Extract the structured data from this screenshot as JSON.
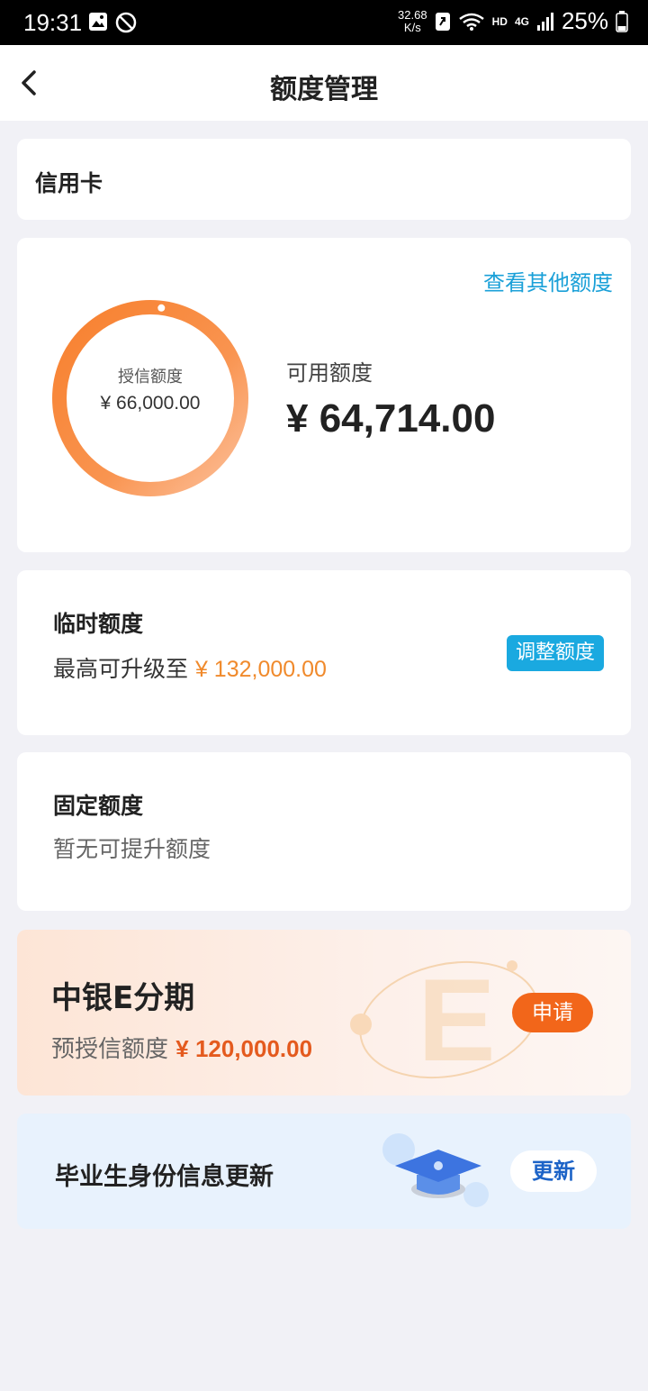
{
  "status_bar": {
    "time": "19:31",
    "speed": "32.68",
    "speed_unit": "K/s",
    "hd": "HD",
    "network": "4G",
    "battery": "25%"
  },
  "nav": {
    "back_icon": "chevron-left-icon",
    "title": "额度管理"
  },
  "card_type": {
    "label": "信用卡"
  },
  "limit_card": {
    "other_link": "查看其他额度",
    "ring_label": "授信额度",
    "ring_value": "¥ 66,000.00",
    "available_label": "可用额度",
    "available_value": "¥ 64,714.00",
    "ring_used_fraction": 0.0195,
    "ring_color": "#f7802e"
  },
  "temp_limit": {
    "title": "临时额度",
    "desc_prefix": "最高可升级至 ",
    "amount": "¥ 132,000.00",
    "button": "调整额度"
  },
  "fixed_limit": {
    "title": "固定额度",
    "desc": "暂无可提升额度"
  },
  "installment": {
    "title": "中银E分期",
    "desc_prefix": "预授信额度 ",
    "amount": "¥ 120,000.00",
    "button": "申请"
  },
  "graduate": {
    "title": "毕业生身份信息更新",
    "button": "更新",
    "icon": "graduation-cap-icon"
  },
  "colors": {
    "accent_blue": "#1aa9e0",
    "accent_orange": "#f2661a"
  }
}
